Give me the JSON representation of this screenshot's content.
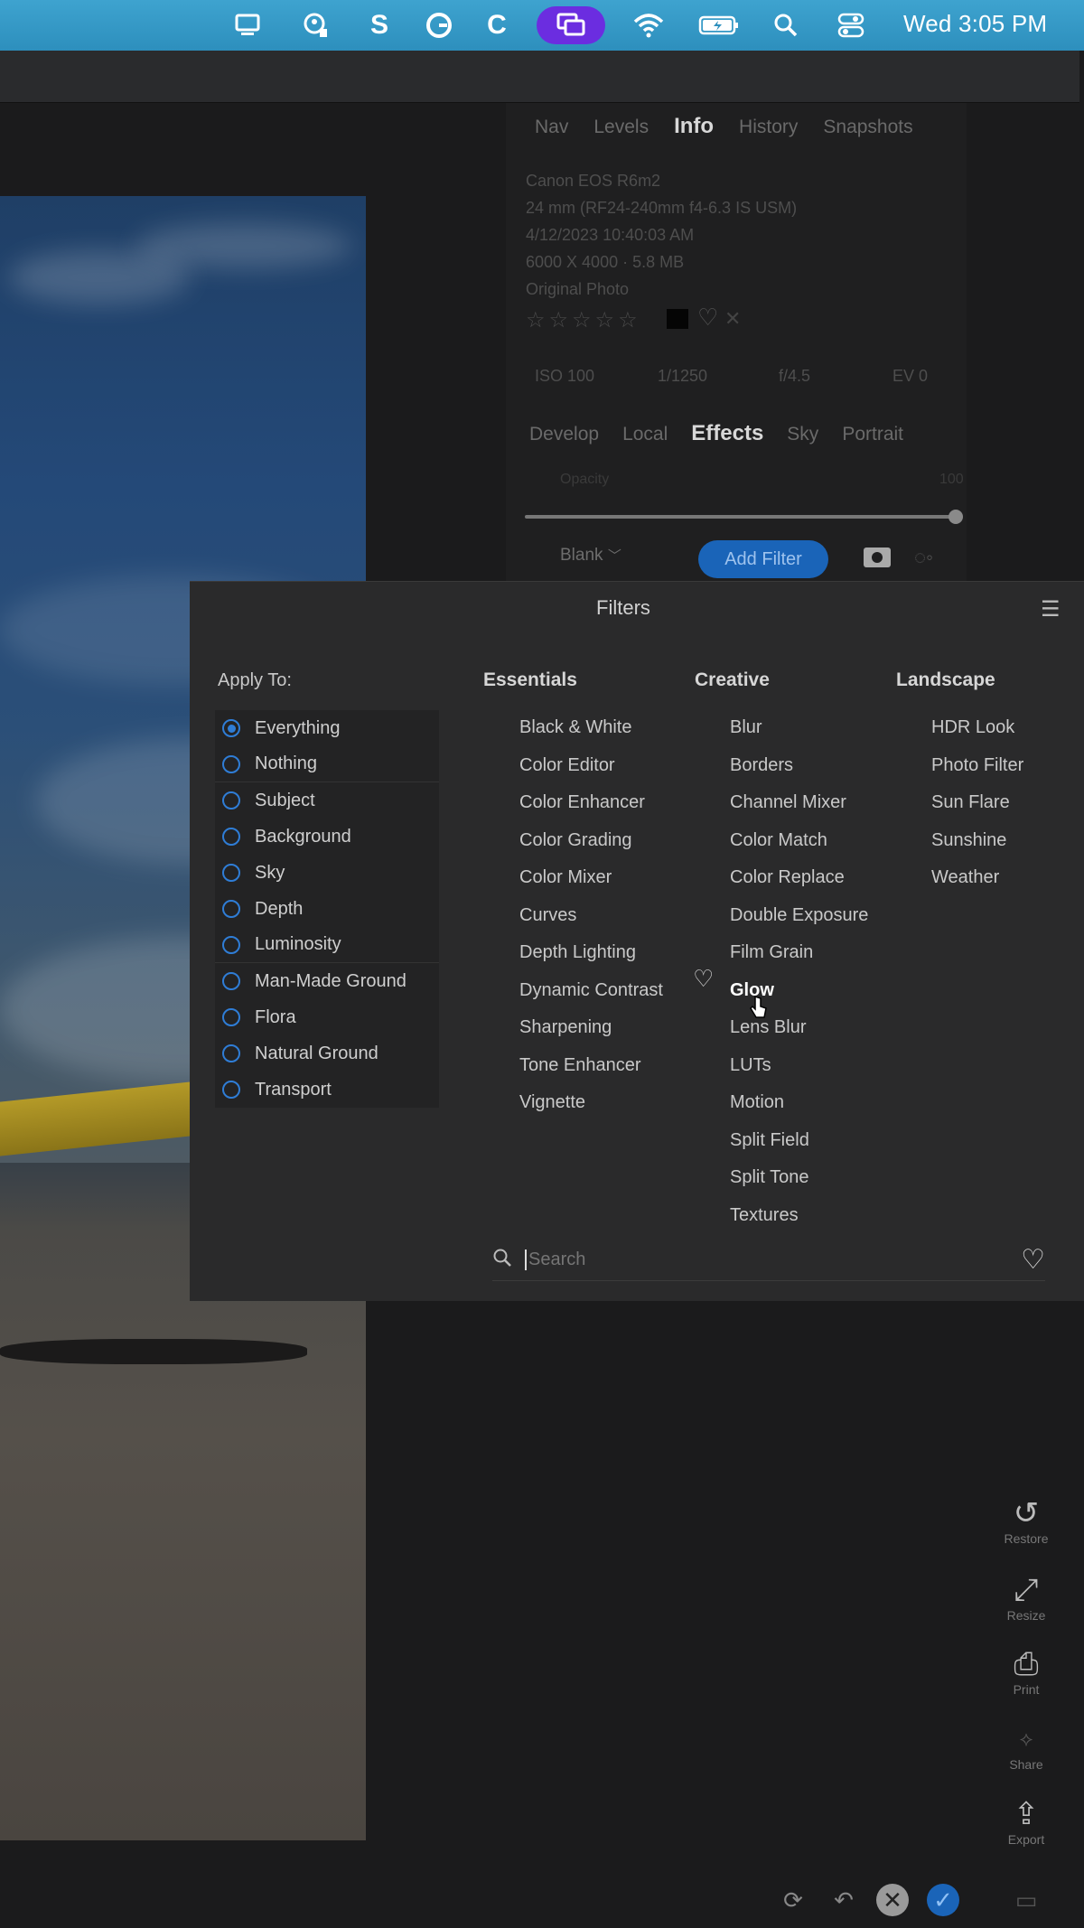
{
  "menubar": {
    "icons": [
      "display-icon",
      "user-shield-icon",
      "s-app-icon",
      "grammarly-icon",
      "c-app-icon",
      "screen-mirror-icon",
      "wifi-icon",
      "battery-icon",
      "search-icon",
      "control-center-icon"
    ],
    "clock": "Wed 3:05 PM",
    "accent": "#2f93c2"
  },
  "panel": {
    "top_tabs": [
      "Nav",
      "Levels",
      "Info",
      "History",
      "Snapshots"
    ],
    "active_top_tab": "Info",
    "info": {
      "camera": "Canon EOS R6m2",
      "lens": "24 mm (RF24-240mm f4-6.3 IS USM)",
      "date": "4/12/2023 10:40:03 AM",
      "size": "6000 X 4000 · 5.8 MB",
      "original": "Original Photo"
    },
    "exif": [
      "ISO 100",
      "1/1250",
      "f/4.5",
      "EV 0"
    ],
    "module_tabs": [
      "Develop",
      "Local",
      "Effects",
      "Sky",
      "Portrait"
    ],
    "active_module_tab": "Effects",
    "opacity_label": "Opacity",
    "opacity_value": "100",
    "blank_label": "Blank",
    "add_filter_label": "Add Filter",
    "accent": "#1a64b8"
  },
  "filters": {
    "title": "Filters",
    "apply_to": {
      "heading": "Apply To:",
      "options": [
        "Everything",
        "Nothing",
        "Subject",
        "Background",
        "Sky",
        "Depth",
        "Luminosity",
        "Man-Made Ground",
        "Flora",
        "Natural Ground",
        "Transport"
      ],
      "selected": "Everything"
    },
    "essentials": {
      "heading": "Essentials",
      "items": [
        "Black & White",
        "Color Editor",
        "Color Enhancer",
        "Color Grading",
        "Color Mixer",
        "Curves",
        "Depth Lighting",
        "Dynamic Contrast",
        "Sharpening",
        "Tone Enhancer",
        "Vignette"
      ]
    },
    "creative": {
      "heading": "Creative",
      "items": [
        "Blur",
        "Borders",
        "Channel Mixer",
        "Color Match",
        "Color Replace",
        "Double Exposure",
        "Film Grain",
        "Glow",
        "Lens Blur",
        "LUTs",
        "Motion",
        "Split Field",
        "Split Tone",
        "Textures"
      ],
      "hovered": "Glow"
    },
    "landscape": {
      "heading": "Landscape",
      "items": [
        "HDR Look",
        "Photo Filter",
        "Sun Flare",
        "Sunshine",
        "Weather"
      ]
    },
    "search_placeholder": "Search"
  },
  "tools": [
    {
      "label": "Restore",
      "icon": "restore-icon"
    },
    {
      "label": "Resize",
      "icon": "resize-icon"
    },
    {
      "label": "Print",
      "icon": "print-icon"
    },
    {
      "label": "Share",
      "icon": "share-icon"
    },
    {
      "label": "Export",
      "icon": "export-icon"
    }
  ]
}
